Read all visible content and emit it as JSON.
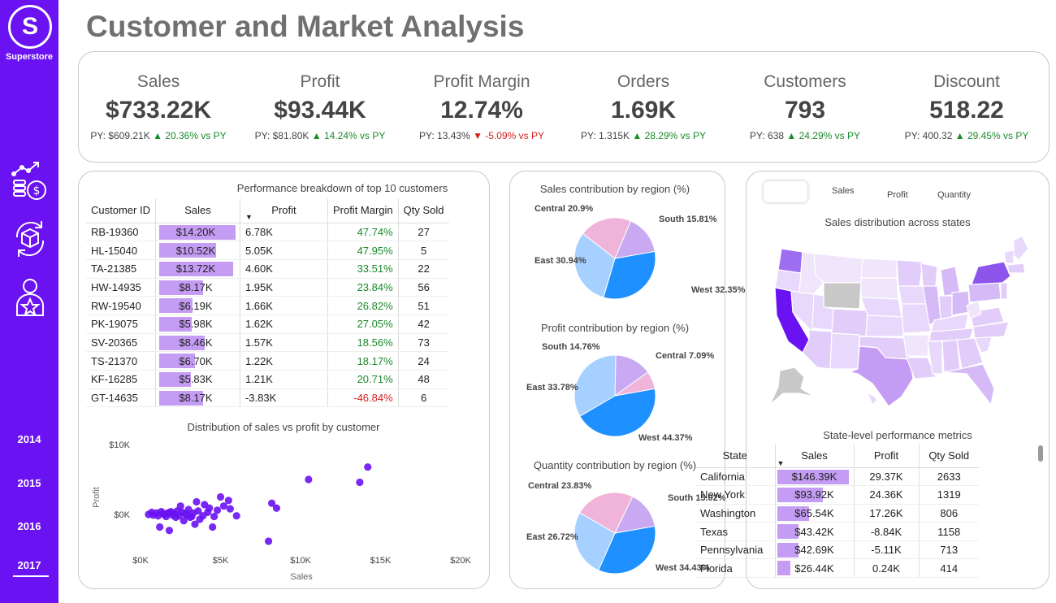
{
  "app": {
    "logo_letter": "S",
    "logo_text": "Superstore",
    "title": "Customer and Market Analysis"
  },
  "years": [
    "2014",
    "2015",
    "2016",
    "2017"
  ],
  "nav_icons": [
    "sales-growth-icon",
    "product-cycle-icon",
    "customer-star-icon"
  ],
  "kpis": [
    {
      "label": "Sales",
      "value": "$733.22K",
      "py": "PY: $609.21K",
      "arrow": "▲",
      "change": "20.36% vs PY",
      "dir": "up"
    },
    {
      "label": "Profit",
      "value": "$93.44K",
      "py": "PY: $81.80K",
      "arrow": "▲",
      "change": "14.24% vs PY",
      "dir": "up"
    },
    {
      "label": "Profit Margin",
      "value": "12.74%",
      "py": "PY: 13.43%",
      "arrow": "▼",
      "change": "-5.09% vs PY",
      "dir": "dn"
    },
    {
      "label": "Orders",
      "value": "1.69K",
      "py": "PY: 1.315K",
      "arrow": "▲",
      "change": "28.29% vs PY",
      "dir": "up"
    },
    {
      "label": "Customers",
      "value": "793",
      "py": "PY: 638",
      "arrow": "▲",
      "change": "24.29% vs PY",
      "dir": "up"
    },
    {
      "label": "Discount",
      "value": "518.22",
      "py": "PY: 400.32",
      "arrow": "▲",
      "change": "29.45% vs PY",
      "dir": "up"
    }
  ],
  "customers": {
    "title": "Performance breakdown of top 10 customers",
    "columns": [
      "Customer ID",
      "Sales",
      "Profit",
      "Profit Margin",
      "Qty Sold"
    ],
    "rows": [
      {
        "id": "RB-19360",
        "sales": "$14.20K",
        "sales_val": 14.2,
        "profit": "6.78K",
        "margin": "47.74%",
        "qty": "27",
        "neg": false
      },
      {
        "id": "HL-15040",
        "sales": "$10.52K",
        "sales_val": 10.52,
        "profit": "5.05K",
        "margin": "47.95%",
        "qty": "5",
        "neg": false
      },
      {
        "id": "TA-21385",
        "sales": "$13.72K",
        "sales_val": 13.72,
        "profit": "4.60K",
        "margin": "33.51%",
        "qty": "22",
        "neg": false
      },
      {
        "id": "HW-14935",
        "sales": "$8.17K",
        "sales_val": 8.17,
        "profit": "1.95K",
        "margin": "23.84%",
        "qty": "56",
        "neg": false
      },
      {
        "id": "RW-19540",
        "sales": "$6.19K",
        "sales_val": 6.19,
        "profit": "1.66K",
        "margin": "26.82%",
        "qty": "51",
        "neg": false
      },
      {
        "id": "PK-19075",
        "sales": "$5.98K",
        "sales_val": 5.98,
        "profit": "1.62K",
        "margin": "27.05%",
        "qty": "42",
        "neg": false
      },
      {
        "id": "SV-20365",
        "sales": "$8.46K",
        "sales_val": 8.46,
        "profit": "1.57K",
        "margin": "18.56%",
        "qty": "73",
        "neg": false
      },
      {
        "id": "TS-21370",
        "sales": "$6.70K",
        "sales_val": 6.7,
        "profit": "1.22K",
        "margin": "18.17%",
        "qty": "24",
        "neg": false
      },
      {
        "id": "KF-16285",
        "sales": "$5.83K",
        "sales_val": 5.83,
        "profit": "1.21K",
        "margin": "20.71%",
        "qty": "48",
        "neg": false
      },
      {
        "id": "GT-14635",
        "sales": "$8.17K",
        "sales_val": 8.17,
        "profit": "-3.83K",
        "margin": "-46.84%",
        "qty": "6",
        "neg": true
      }
    ]
  },
  "chart_data": [
    {
      "type": "scatter",
      "title": "Distribution of sales vs profit by customer",
      "xlabel": "Sales",
      "ylabel": "Profit",
      "x_ticks": [
        "$0K",
        "$5K",
        "$10K",
        "$15K",
        "$20K"
      ],
      "y_ticks": [
        "$10K",
        "$0K"
      ],
      "xlim": [
        0,
        20000
      ],
      "ylim": [
        -4500,
        10000
      ],
      "color": "#6a12f2",
      "points": [
        [
          10500,
          5000
        ],
        [
          14200,
          6780
        ],
        [
          13700,
          4600
        ],
        [
          5000,
          2500
        ],
        [
          5500,
          2000
        ],
        [
          8200,
          1600
        ],
        [
          8500,
          900
        ],
        [
          8000,
          -3830
        ],
        [
          1200,
          -1800
        ],
        [
          1800,
          -2300
        ],
        [
          3400,
          -1400
        ],
        [
          4500,
          -1800
        ],
        [
          2500,
          1200
        ],
        [
          3000,
          700
        ],
        [
          3500,
          1800
        ],
        [
          4000,
          1400
        ],
        [
          4300,
          900
        ],
        [
          2200,
          -400
        ],
        [
          2700,
          -900
        ],
        [
          3700,
          -700
        ],
        [
          4600,
          -300
        ],
        [
          1800,
          200
        ],
        [
          2400,
          -200
        ],
        [
          3100,
          -400
        ],
        [
          500,
          0
        ],
        [
          800,
          -100
        ],
        [
          1000,
          200
        ],
        [
          1400,
          100
        ],
        [
          1600,
          -300
        ],
        [
          1900,
          400
        ],
        [
          2100,
          100
        ],
        [
          2600,
          300
        ],
        [
          2900,
          -100
        ],
        [
          3300,
          200
        ],
        [
          3600,
          500
        ],
        [
          3900,
          -200
        ],
        [
          4200,
          300
        ],
        [
          4800,
          600
        ],
        [
          5200,
          1200
        ],
        [
          5600,
          800
        ],
        [
          6000,
          -200
        ],
        [
          700,
          300
        ],
        [
          1100,
          -200
        ],
        [
          1300,
          400
        ],
        [
          1500,
          0
        ],
        [
          1700,
          200
        ],
        [
          2000,
          -100
        ],
        [
          2300,
          500
        ],
        [
          2800,
          100
        ],
        [
          3200,
          -300
        ]
      ]
    },
    {
      "type": "pie",
      "title": "Sales contribution by region (%)",
      "slices": [
        {
          "label": "West",
          "value": 32.35,
          "display": "West 32.35%",
          "color": "#1e90ff"
        },
        {
          "label": "East",
          "value": 30.94,
          "display": "East 30.94%",
          "color": "#a5d0ff"
        },
        {
          "label": "Central",
          "value": 20.9,
          "display": "Central 20.9%",
          "color": "#f0b3d9"
        },
        {
          "label": "South",
          "value": 15.81,
          "display": "South 15.81%",
          "color": "#c8a9f2"
        }
      ]
    },
    {
      "type": "pie",
      "title": "Profit contribution by region (%)",
      "slices": [
        {
          "label": "West",
          "value": 44.37,
          "display": "West 44.37%",
          "color": "#1e90ff"
        },
        {
          "label": "East",
          "value": 33.78,
          "display": "East 33.78%",
          "color": "#a5d0ff"
        },
        {
          "label": "South",
          "value": 14.76,
          "display": "South 14.76%",
          "color": "#c8a9f2"
        },
        {
          "label": "Central",
          "value": 7.09,
          "display": "Central 7.09%",
          "color": "#f0b3d9"
        }
      ]
    },
    {
      "type": "pie",
      "title": "Quantity contribution by region (%)",
      "slices": [
        {
          "label": "West",
          "value": 34.43,
          "display": "West 34.43%",
          "color": "#1e90ff"
        },
        {
          "label": "East",
          "value": 26.72,
          "display": "East 26.72%",
          "color": "#a5d0ff"
        },
        {
          "label": "Central",
          "value": 23.83,
          "display": "Central 23.83%",
          "color": "#f0b3d9"
        },
        {
          "label": "South",
          "value": 15.02,
          "display": "South 15.02%",
          "color": "#c8a9f2"
        }
      ]
    }
  ],
  "map": {
    "tabs": [
      "Sales",
      "Profit",
      "Quantity"
    ],
    "title": "Sales distribution across states"
  },
  "states": {
    "title": "State-level performance metrics",
    "columns": [
      "State",
      "Sales",
      "Profit",
      "Qty Sold"
    ],
    "rows": [
      {
        "state": "California",
        "sales": "$146.39K",
        "sales_val": 146.39,
        "profit": "29.37K",
        "qty": "2633"
      },
      {
        "state": "New York",
        "sales": "$93.92K",
        "sales_val": 93.92,
        "profit": "24.36K",
        "qty": "1319"
      },
      {
        "state": "Washington",
        "sales": "$65.54K",
        "sales_val": 65.54,
        "profit": "17.26K",
        "qty": "806"
      },
      {
        "state": "Texas",
        "sales": "$43.42K",
        "sales_val": 43.42,
        "profit": "-8.84K",
        "qty": "1158"
      },
      {
        "state": "Pennsylvania",
        "sales": "$42.69K",
        "sales_val": 42.69,
        "profit": "-5.11K",
        "qty": "713"
      },
      {
        "state": "Florida",
        "sales": "$26.44K",
        "sales_val": 26.44,
        "profit": "0.24K",
        "qty": "414"
      }
    ]
  }
}
